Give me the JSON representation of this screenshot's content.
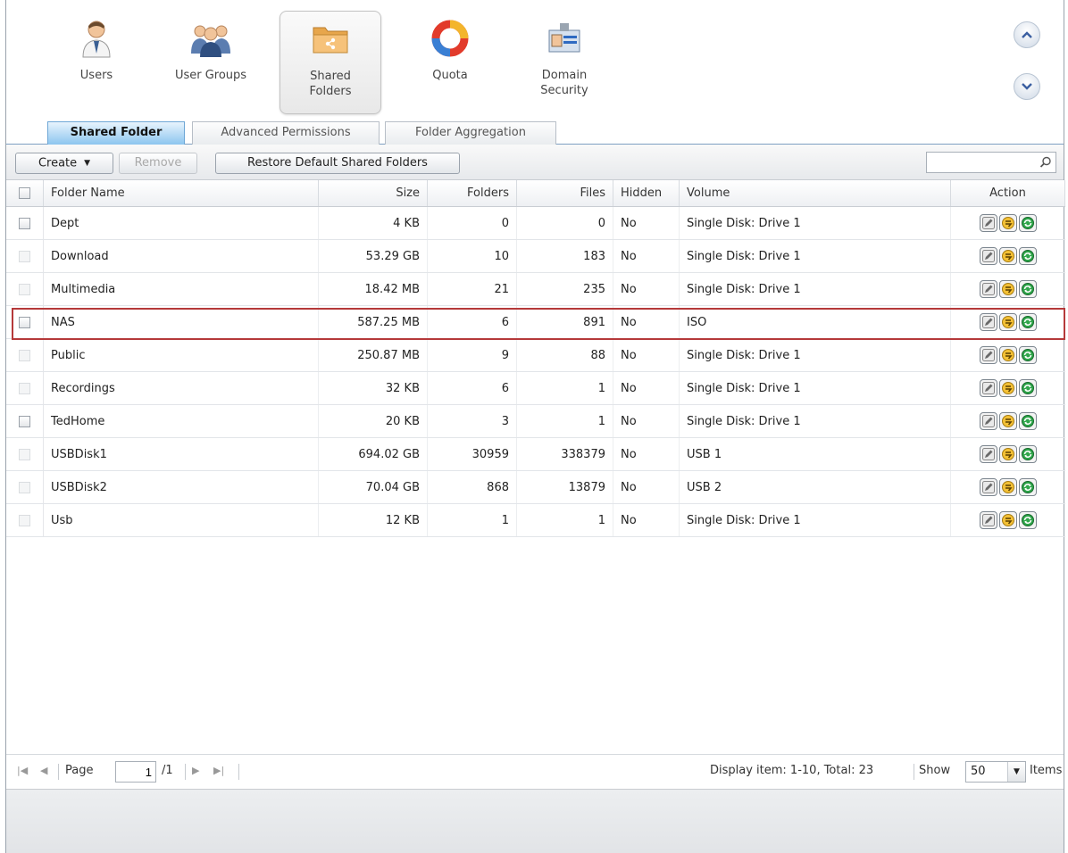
{
  "nav": {
    "users": "Users",
    "user_groups": "User Groups",
    "shared_folders_line1": "Shared",
    "shared_folders_line2": "Folders",
    "quota": "Quota",
    "domain_security_line1": "Domain",
    "domain_security_line2": "Security"
  },
  "tabs": {
    "shared_folder": "Shared Folder",
    "advanced_permissions": "Advanced Permissions",
    "folder_aggregation": "Folder Aggregation"
  },
  "toolbar": {
    "create": "Create",
    "remove": "Remove",
    "restore": "Restore Default Shared Folders"
  },
  "columns": {
    "folder_name": "Folder Name",
    "size": "Size",
    "folders": "Folders",
    "files": "Files",
    "hidden": "Hidden",
    "volume": "Volume",
    "action": "Action"
  },
  "rows": [
    {
      "name": "Dept",
      "size": "4 KB",
      "folders": "0",
      "files": "0",
      "hidden": "No",
      "volume": "Single Disk: Drive 1",
      "checkable": true
    },
    {
      "name": "Download",
      "size": "53.29 GB",
      "folders": "10",
      "files": "183",
      "hidden": "No",
      "volume": "Single Disk: Drive 1",
      "checkable": false
    },
    {
      "name": "Multimedia",
      "size": "18.42 MB",
      "folders": "21",
      "files": "235",
      "hidden": "No",
      "volume": "Single Disk: Drive 1",
      "checkable": false
    },
    {
      "name": "NAS",
      "size": "587.25 MB",
      "folders": "6",
      "files": "891",
      "hidden": "No",
      "volume": "ISO",
      "checkable": true
    },
    {
      "name": "Public",
      "size": "250.87 MB",
      "folders": "9",
      "files": "88",
      "hidden": "No",
      "volume": "Single Disk: Drive 1",
      "checkable": false
    },
    {
      "name": "Recordings",
      "size": "32 KB",
      "folders": "6",
      "files": "1",
      "hidden": "No",
      "volume": "Single Disk: Drive 1",
      "checkable": false
    },
    {
      "name": "TedHome",
      "size": "20 KB",
      "folders": "3",
      "files": "1",
      "hidden": "No",
      "volume": "Single Disk: Drive 1",
      "checkable": true
    },
    {
      "name": "USBDisk1",
      "size": "694.02 GB",
      "folders": "30959",
      "files": "338379",
      "hidden": "No",
      "volume": "USB 1",
      "checkable": false
    },
    {
      "name": "USBDisk2",
      "size": "70.04 GB",
      "folders": "868",
      "files": "13879",
      "hidden": "No",
      "volume": "USB 2",
      "checkable": false
    },
    {
      "name": "Usb",
      "size": "12 KB",
      "folders": "1",
      "files": "1",
      "hidden": "No",
      "volume": "Single Disk: Drive 1",
      "checkable": false
    }
  ],
  "pager": {
    "page_label": "Page",
    "page_value": "1",
    "page_total": "/1",
    "display_info": "Display item: 1-10, Total: 23",
    "show_label": "Show",
    "show_value": "50",
    "items_label": "Items"
  },
  "icons": {
    "edit": "edit-icon",
    "permissions": "permissions-icon",
    "refresh": "refresh-icon"
  },
  "colors": {
    "active_tab": "#8cc5ef",
    "highlight": "#b5393a"
  }
}
